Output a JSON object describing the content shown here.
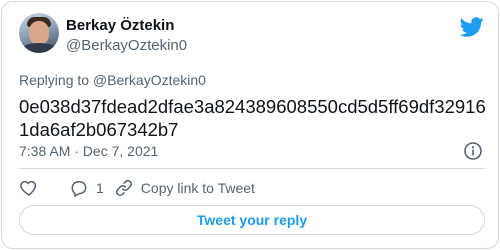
{
  "author": {
    "name": "Berkay Öztekin",
    "handle": "@BerkayOztekin0"
  },
  "reply_context": "Replying to @BerkayOztekin0",
  "tweet": {
    "text": "0e038d37fdead2dfae3a824389608550cd5d5ff69df329161da6af2b067342b7",
    "timestamp": "7:38 AM · Dec 7, 2021"
  },
  "actions": {
    "reply_count": "1",
    "copy_link_label": "Copy link to Tweet"
  },
  "reply_button_label": "Tweet your reply",
  "colors": {
    "accent": "#1d9bf0",
    "text": "#0f1419",
    "secondary": "#536471",
    "border": "#cfd9de"
  },
  "icons": [
    "twitter-bird-icon",
    "info-icon",
    "heart-icon",
    "reply-icon",
    "link-icon"
  ]
}
